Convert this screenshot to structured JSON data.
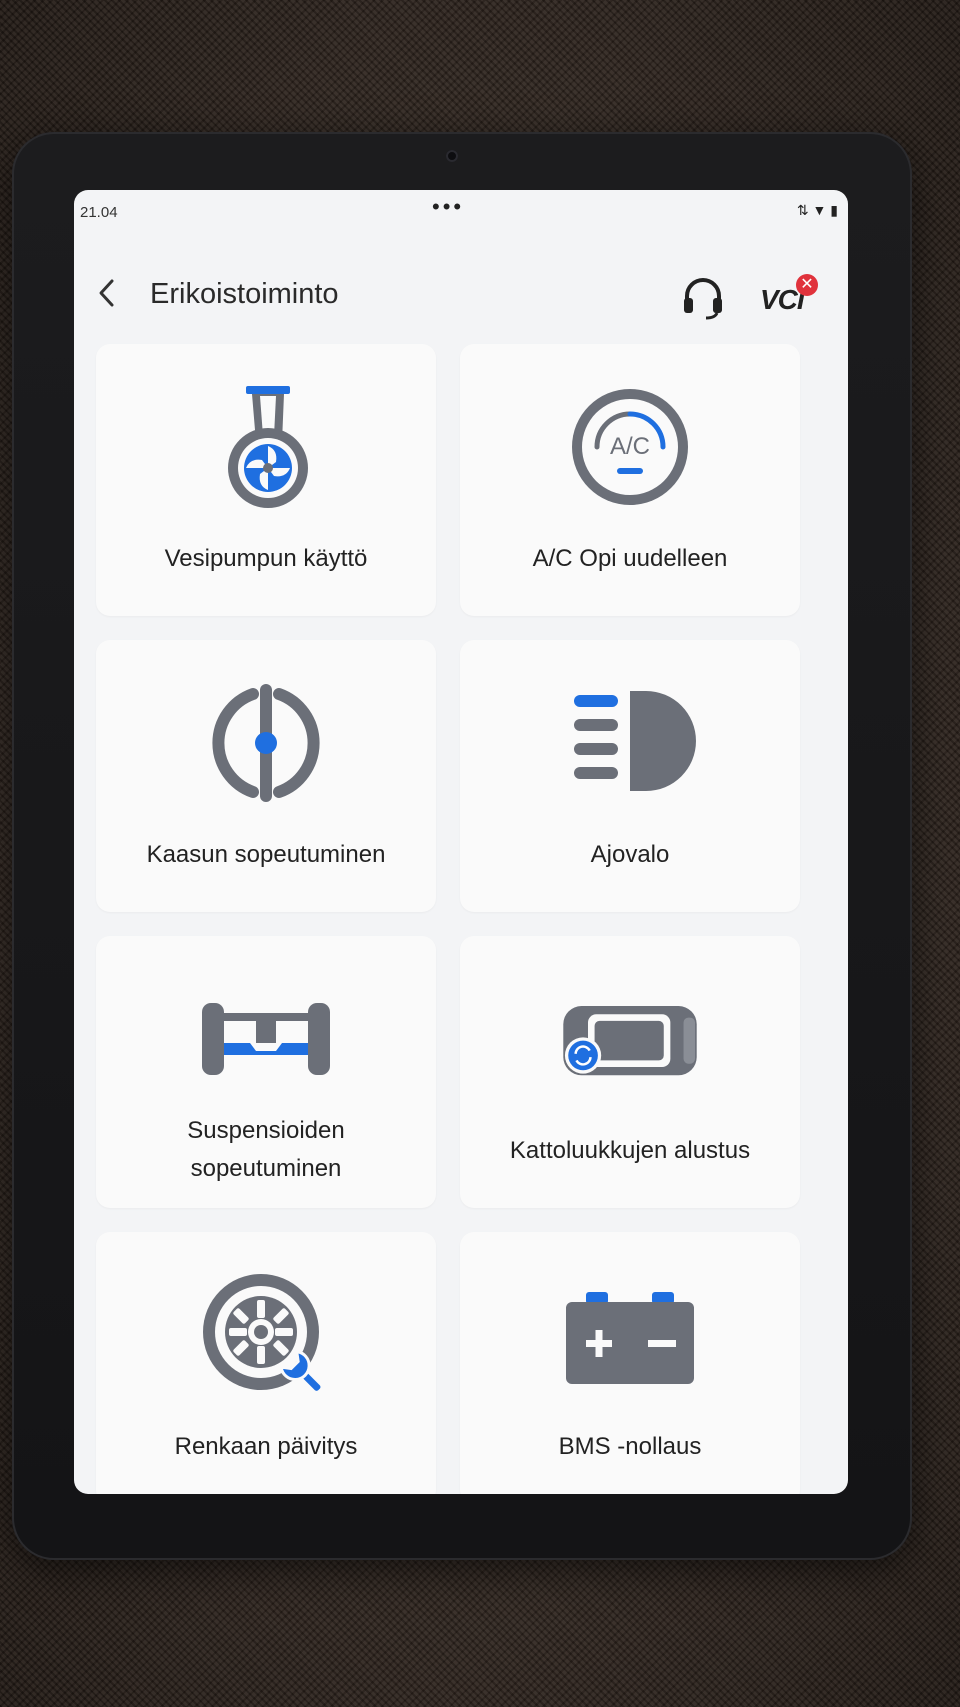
{
  "status_bar": {
    "time": "21.04",
    "icons": "⇅ ▼ ▮"
  },
  "header": {
    "back_label": "‹",
    "title": "Erikoistoiminto",
    "support_icon": "headset-icon",
    "vci_label": "VCI",
    "vci_badge": "✕"
  },
  "colors": {
    "accent": "#1f6fe0",
    "icon_gray": "#6b6f78",
    "tile_bg": "#fafafa",
    "screen_bg": "#f3f4f6",
    "badge": "#e0323c"
  },
  "tiles": [
    {
      "label": "Vesipumpun käyttö",
      "icon": "water-pump-icon"
    },
    {
      "label": "A/C Opi uudelleen",
      "icon": "ac-relearn-icon",
      "icon_text": "A/C"
    },
    {
      "label": "Kaasun sopeutuminen",
      "icon": "throttle-icon"
    },
    {
      "label": "Ajovalo",
      "icon": "headlight-icon"
    },
    {
      "label_line1": "Suspensioiden",
      "label_line2": "sopeutuminen",
      "icon": "suspension-icon"
    },
    {
      "label": "Kattoluukkujen alustus",
      "icon": "sunroof-icon"
    },
    {
      "label": "Renkaan päivitys",
      "icon": "tire-wrench-icon"
    },
    {
      "label": "BMS -nollaus",
      "icon": "battery-icon"
    }
  ]
}
